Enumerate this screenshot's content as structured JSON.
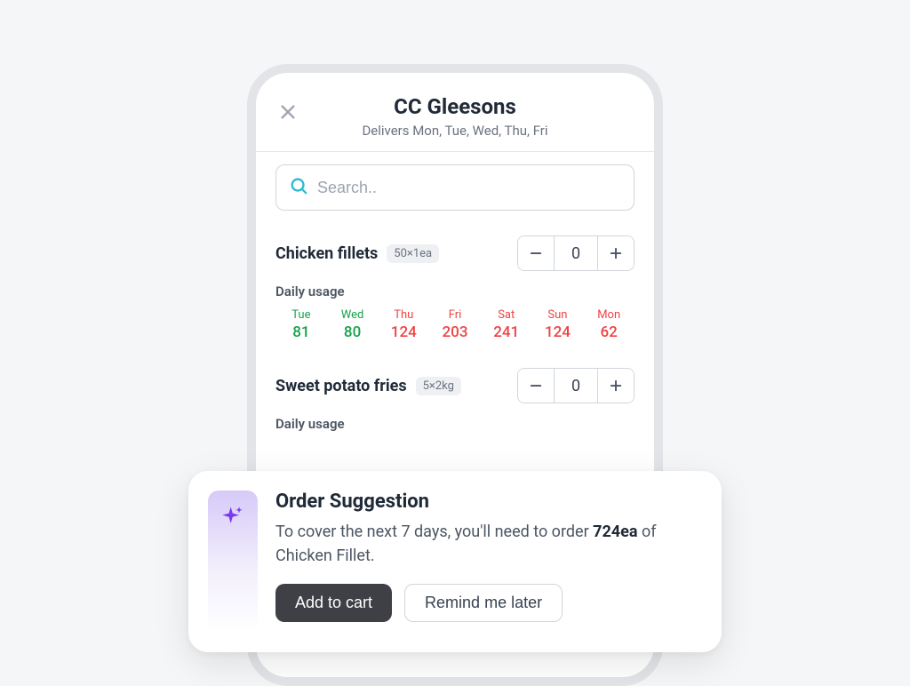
{
  "header": {
    "title": "CC Gleesons",
    "subtitle": "Delivers Mon, Tue, Wed, Thu, Fri"
  },
  "search": {
    "placeholder": "Search.."
  },
  "items": [
    {
      "name": "Chicken fillets",
      "pack": "50×1ea",
      "qty": "0",
      "usage_label": "Daily usage",
      "usage": [
        {
          "day": "Tue",
          "value": "81",
          "color": "green"
        },
        {
          "day": "Wed",
          "value": "80",
          "color": "green"
        },
        {
          "day": "Thu",
          "value": "124",
          "color": "red"
        },
        {
          "day": "Fri",
          "value": "203",
          "color": "red"
        },
        {
          "day": "Sat",
          "value": "241",
          "color": "red"
        },
        {
          "day": "Sun",
          "value": "124",
          "color": "red"
        },
        {
          "day": "Mon",
          "value": "62",
          "color": "red"
        }
      ]
    },
    {
      "name": "Sweet potato fries",
      "pack": "5×2kg",
      "qty": "0",
      "usage_label": "Daily usage"
    }
  ],
  "suggestion": {
    "title": "Order Suggestion",
    "body_pre": "To cover the next 7 days, you'll need to order ",
    "body_strong": "724ea",
    "body_post": " of Chicken Fillet.",
    "add_label": "Add to cart",
    "remind_label": "Remind me later"
  }
}
